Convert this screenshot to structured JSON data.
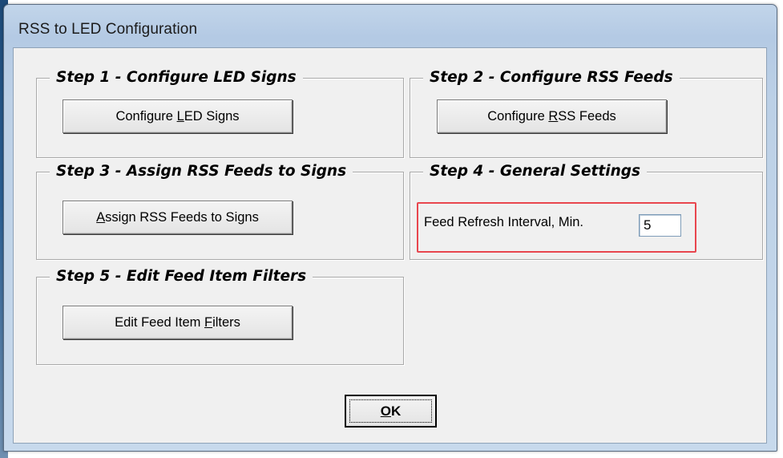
{
  "window": {
    "title": "RSS to LED Configuration"
  },
  "steps": {
    "step1": {
      "legend": "Step 1 - Configure LED Signs",
      "button_pre": "Configure ",
      "button_key": "L",
      "button_post": "ED Signs"
    },
    "step2": {
      "legend": "Step 2 - Configure RSS Feeds",
      "button_pre": "Configure ",
      "button_key": "R",
      "button_post": "SS Feeds"
    },
    "step3": {
      "legend": "Step 3 - Assign RSS Feeds to Signs",
      "button_pre": "",
      "button_key": "A",
      "button_post": "ssign RSS Feeds to Signs"
    },
    "step4": {
      "legend": "Step 4 - General Settings",
      "field_label": "Feed Refresh Interval, Min.",
      "field_value": "5"
    },
    "step5": {
      "legend": "Step 5 - Edit Feed Item Filters",
      "button_pre": "Edit Feed Item ",
      "button_key": "F",
      "button_post": "ilters"
    }
  },
  "ok_button": {
    "key": "O",
    "rest": "K"
  },
  "colors": {
    "highlight": "#e8464e",
    "dialog_face": "#f0f0f0",
    "title_bar": "#b4cae4"
  }
}
